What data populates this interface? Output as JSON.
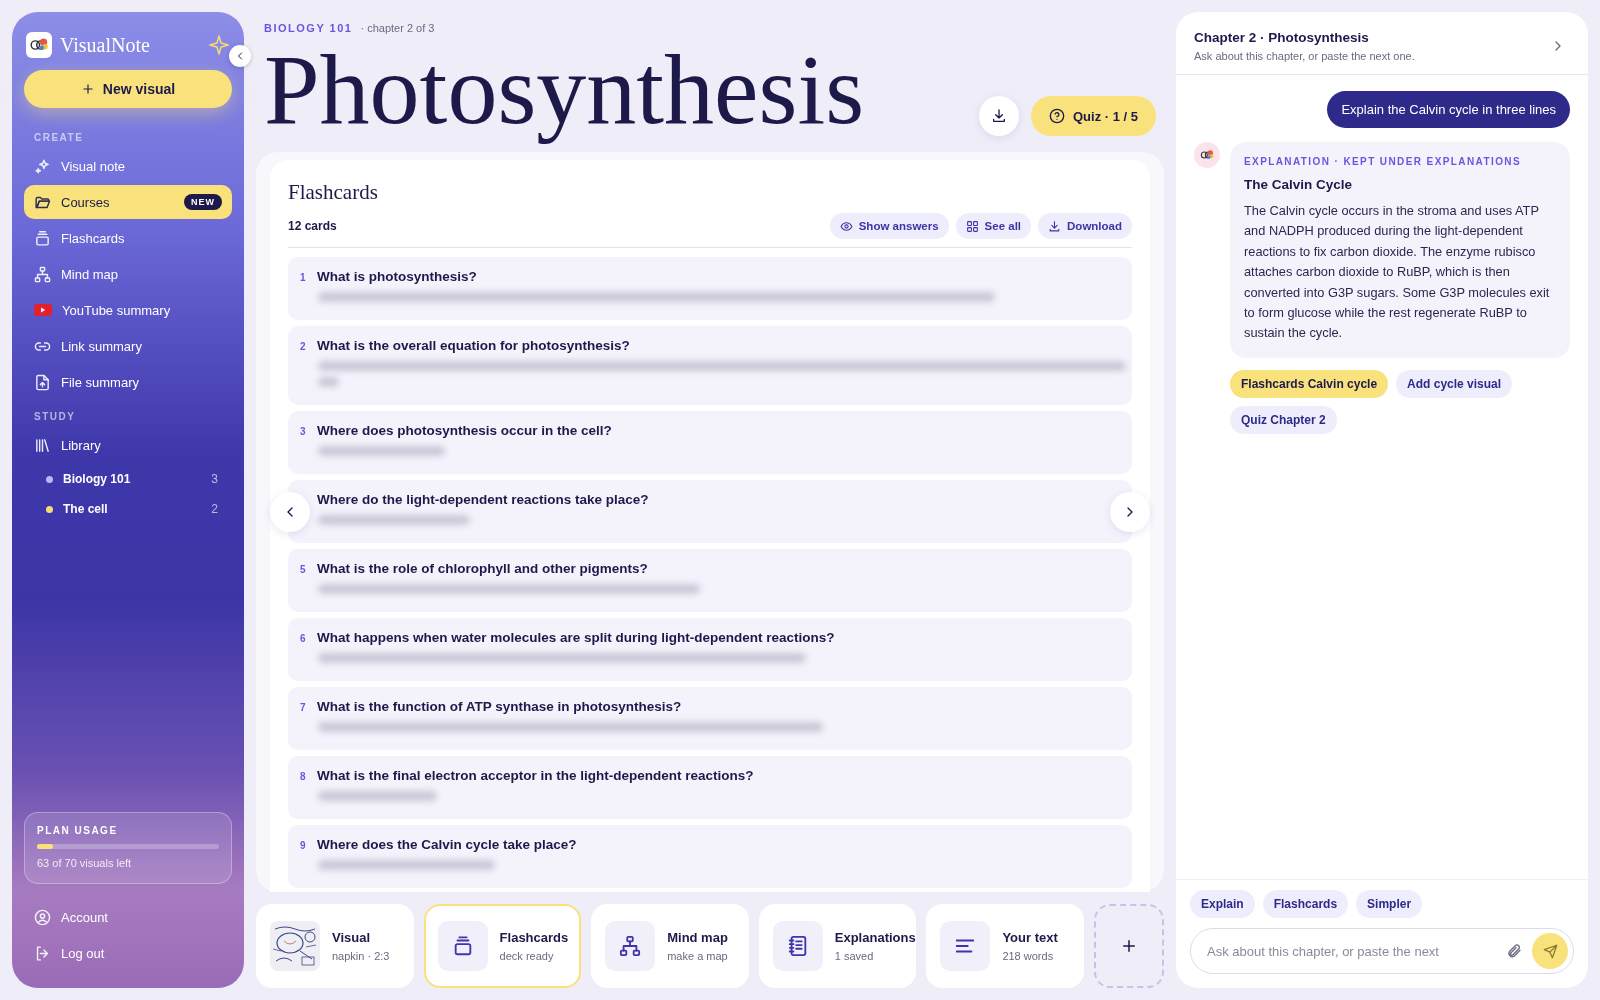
{
  "sidebar": {
    "logo": "VisualNote",
    "new_button": "New visual",
    "sections": [
      {
        "heading": "CREATE",
        "items": [
          {
            "label": "Visual note",
            "selected": false
          },
          {
            "label": "Courses",
            "selected": true,
            "badge": "NEW"
          },
          {
            "label": "Flashcards",
            "selected": false
          },
          {
            "label": "Mind map",
            "selected": false
          },
          {
            "label": "YouTube summary",
            "selected": false
          },
          {
            "label": "Link summary",
            "selected": false
          },
          {
            "label": "File summary",
            "selected": false
          }
        ]
      },
      {
        "heading": "STUDY",
        "items": [
          {
            "label": "Library",
            "selected": false,
            "children": [
              {
                "label": "Biology 101",
                "count": "3",
                "color": "#bcb8f7"
              },
              {
                "label": "The cell",
                "count": "2",
                "color": "#f7dc6f"
              }
            ]
          }
        ]
      }
    ],
    "plan_usage": {
      "heading": "PLAN USAGE",
      "level": 0.09,
      "caption": "63 of 70 visuals left"
    },
    "footer": [
      {
        "label": "Account"
      },
      {
        "label": "Log out"
      }
    ]
  },
  "header": {
    "course": "BIOLOGY 101",
    "chapter": "· chapter 2 of 3",
    "title": "Photosynthesis",
    "quiz_button": "Quiz · 1 / 5"
  },
  "flashcards": {
    "title": "Flashcards",
    "count": "12 cards",
    "actions": [
      "Show answers",
      "See all",
      "Download"
    ],
    "answers_shown": false,
    "cards": [
      {
        "number": "1",
        "question": "What is photosynthesis?"
      },
      {
        "number": "2",
        "question": "What is the overall equation for photosynthesis?"
      },
      {
        "number": "3",
        "question": "Where does photosynthesis occur in the cell?"
      },
      {
        "question": "Where do the light-dependent reactions take place?"
      },
      {
        "number": "5",
        "question": "What is the role of chlorophyll and other pigments?"
      },
      {
        "number": "6",
        "question": "What happens when water molecules are split during light-dependent reactions?"
      },
      {
        "number": "7",
        "question": "What is the function of ATP synthase in photosynthesis?"
      },
      {
        "number": "8",
        "question": "What is the final electron acceptor in the light-dependent reactions?"
      },
      {
        "number": "9",
        "question": "Where does the Calvin cycle take place?"
      }
    ]
  },
  "bottom_tabs": [
    {
      "kind": "picture",
      "title": "Visual",
      "subtitle": "napkin · 2:3",
      "selected": false
    },
    {
      "kind": "icon",
      "title": "Flashcards",
      "subtitle": "deck ready",
      "selected": true
    },
    {
      "kind": "icon",
      "title": "Mind map",
      "subtitle": "make a map",
      "selected": false
    },
    {
      "kind": "icon",
      "title": "Explanations",
      "subtitle": "1 saved",
      "selected": false
    },
    {
      "kind": "icon",
      "title": "Your text",
      "subtitle": "218 words",
      "selected": false
    }
  ],
  "chat": {
    "title": "Chapter 2 · Photosynthesis",
    "subtitle": "Ask about this chapter, or paste the next one.",
    "messages": [
      {
        "kind": "user",
        "text": "Explain the Calvin cycle in three lines"
      },
      {
        "kind": "assistant",
        "label": "EXPLANATION · KEPT UNDER EXPLANATIONS",
        "title": "The Calvin Cycle",
        "body": "The Calvin cycle occurs in the stroma and uses ATP and NADPH produced during the light-dependent reactions to fix carbon dioxide. The enzyme rubisco attaches carbon dioxide to RuBP, which is then converted into G3P sugars. Some G3P molecules exit to form glucose while the rest regenerate RuBP to sustain the cycle."
      }
    ],
    "suggestions": [
      {
        "label": "Flashcards Calvin cycle",
        "highlighted": true
      },
      {
        "label": "Add cycle visual",
        "highlighted": false
      },
      {
        "label": "Quiz Chapter 2",
        "highlighted": false
      }
    ],
    "quick_actions": [
      "Explain",
      "Flashcards",
      "Simpler"
    ],
    "input": {
      "placeholder": "Ask about this chapter, or paste the next"
    }
  }
}
